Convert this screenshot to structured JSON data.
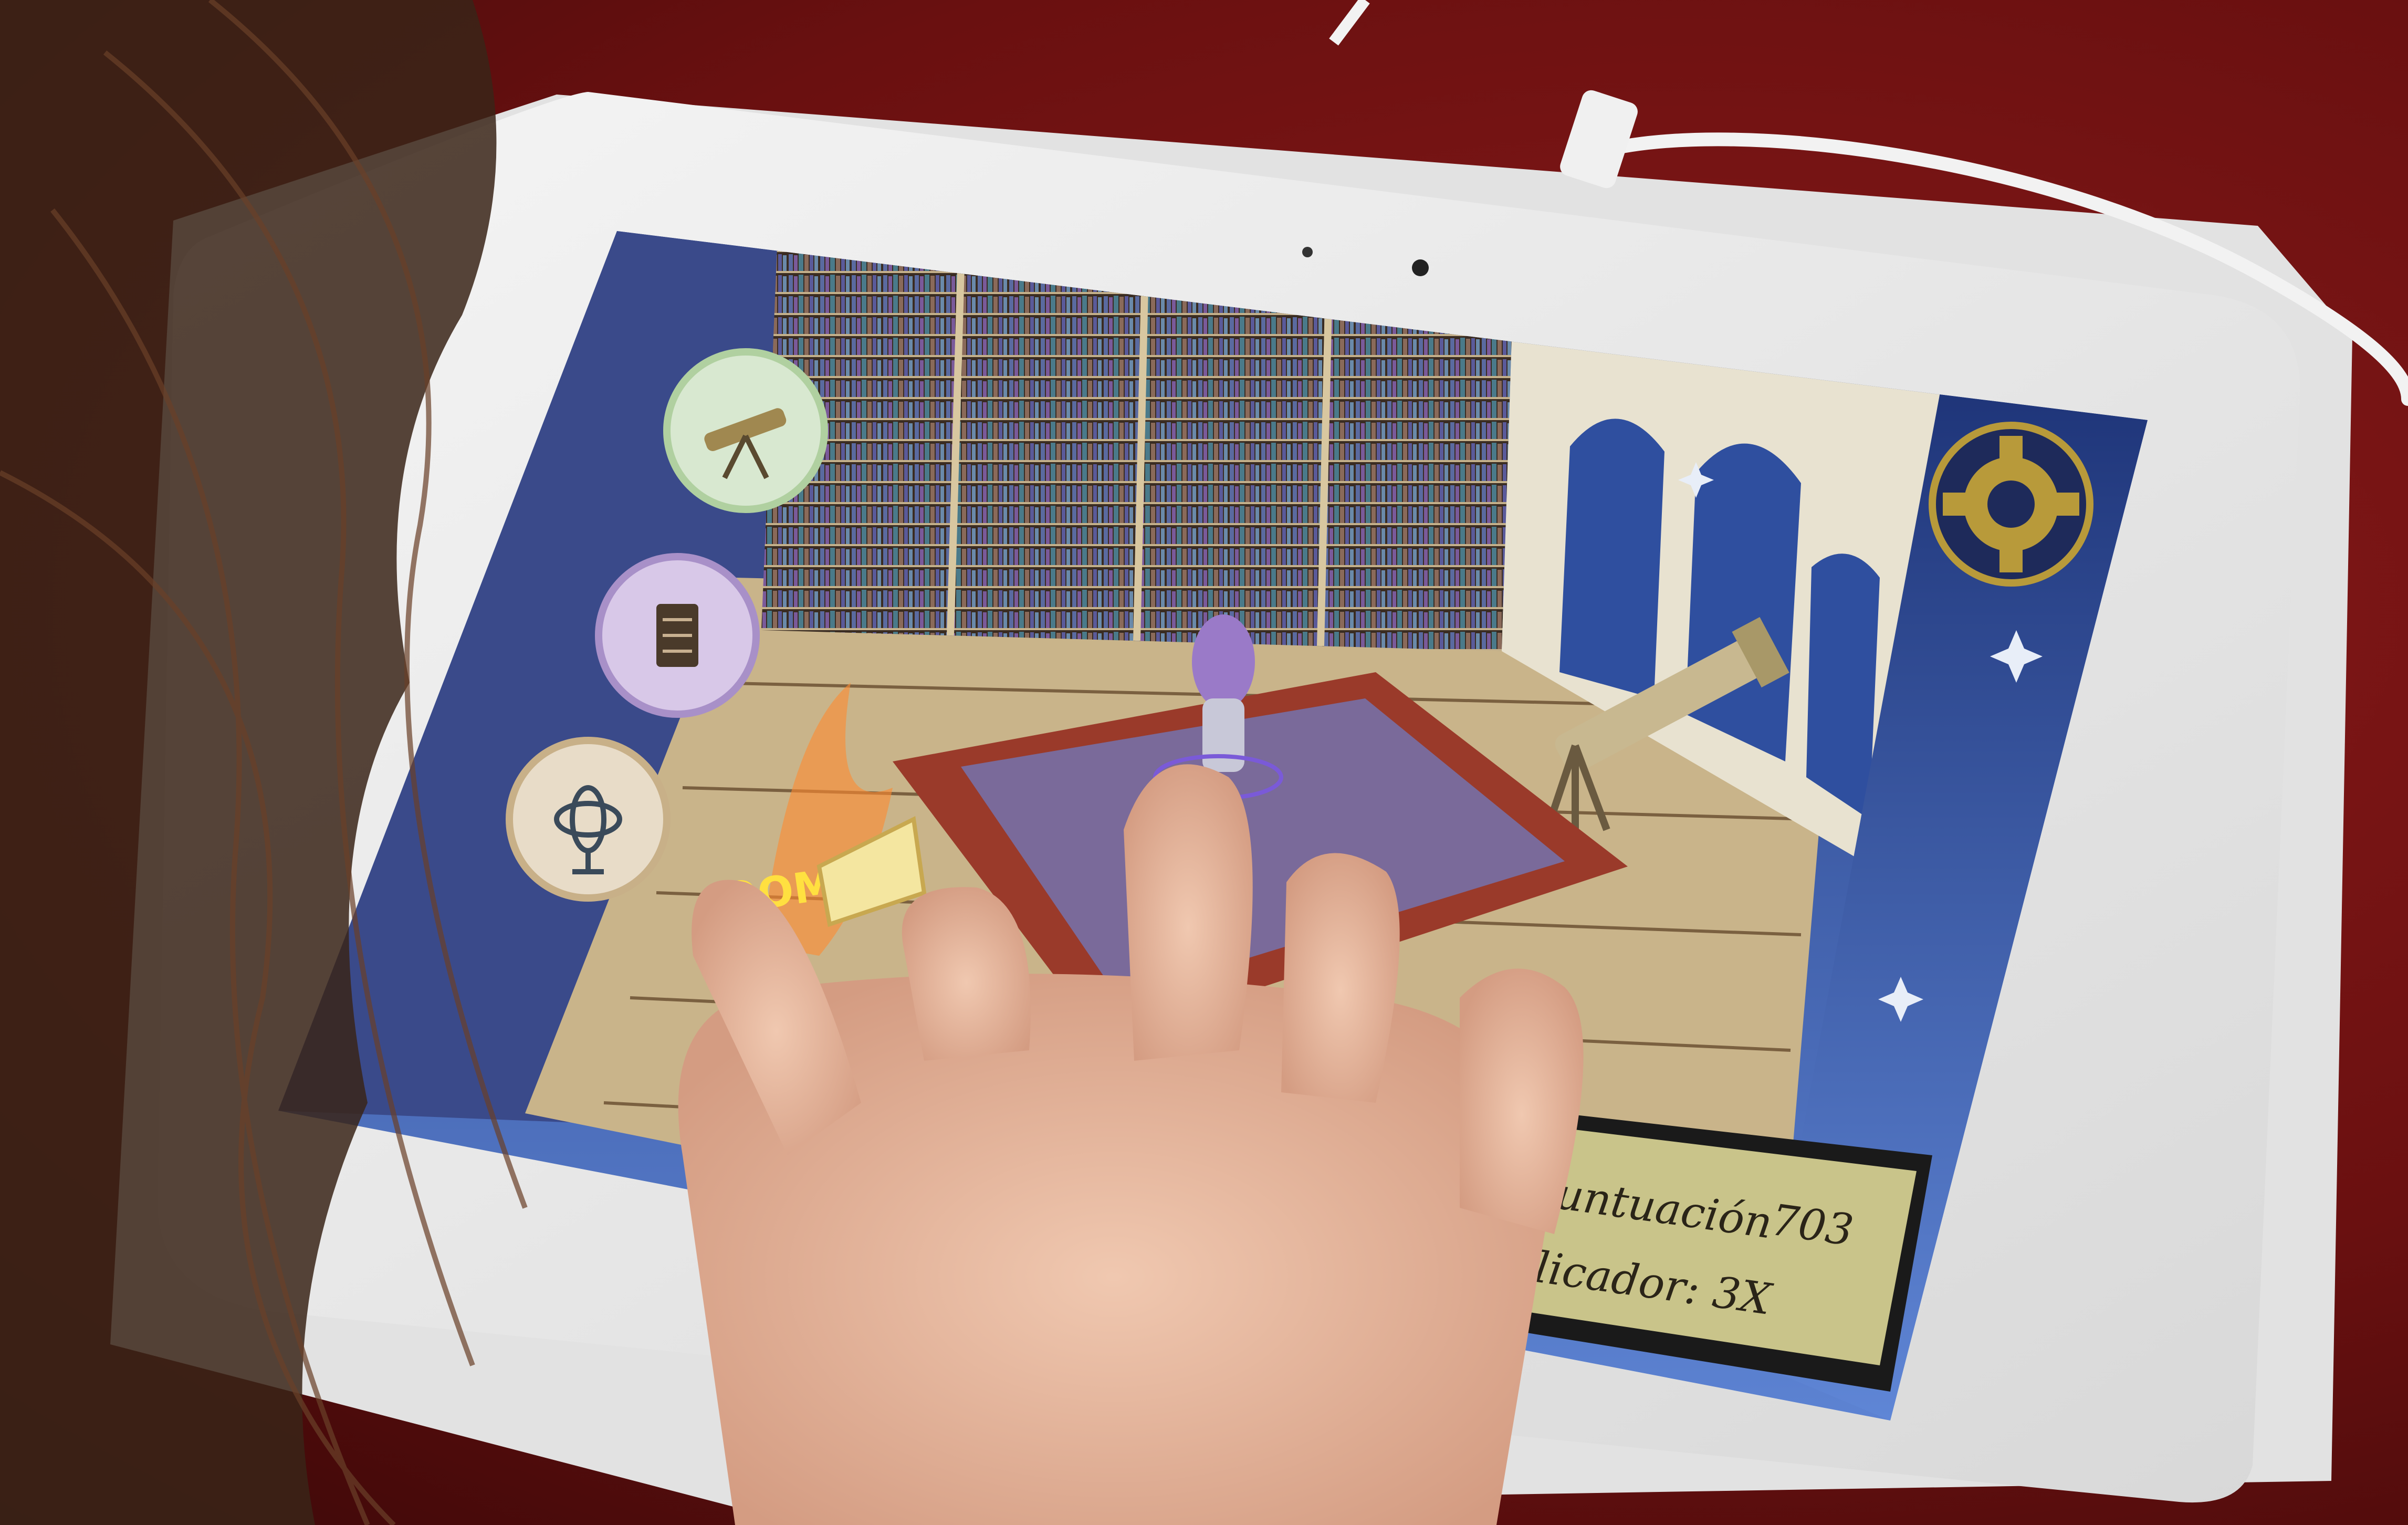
{
  "game": {
    "hud": {
      "score_label": "untuación",
      "score_value": "703",
      "multiplier_label": "licador: 3X"
    },
    "sidebar_icons": [
      "telescope-icon",
      "book-icon",
      "armillary-sphere-icon"
    ],
    "settings_icon": "gear-icon",
    "effect_text": "OOM",
    "colors": {
      "table_background": "#6a1010",
      "tablet_bezel": "#eeeeee",
      "sky_blue": "#2f4f9f",
      "hud_panel": "#c9c48a",
      "rug_red": "#9a3a2a",
      "gear_gold": "#b89a3a"
    }
  }
}
